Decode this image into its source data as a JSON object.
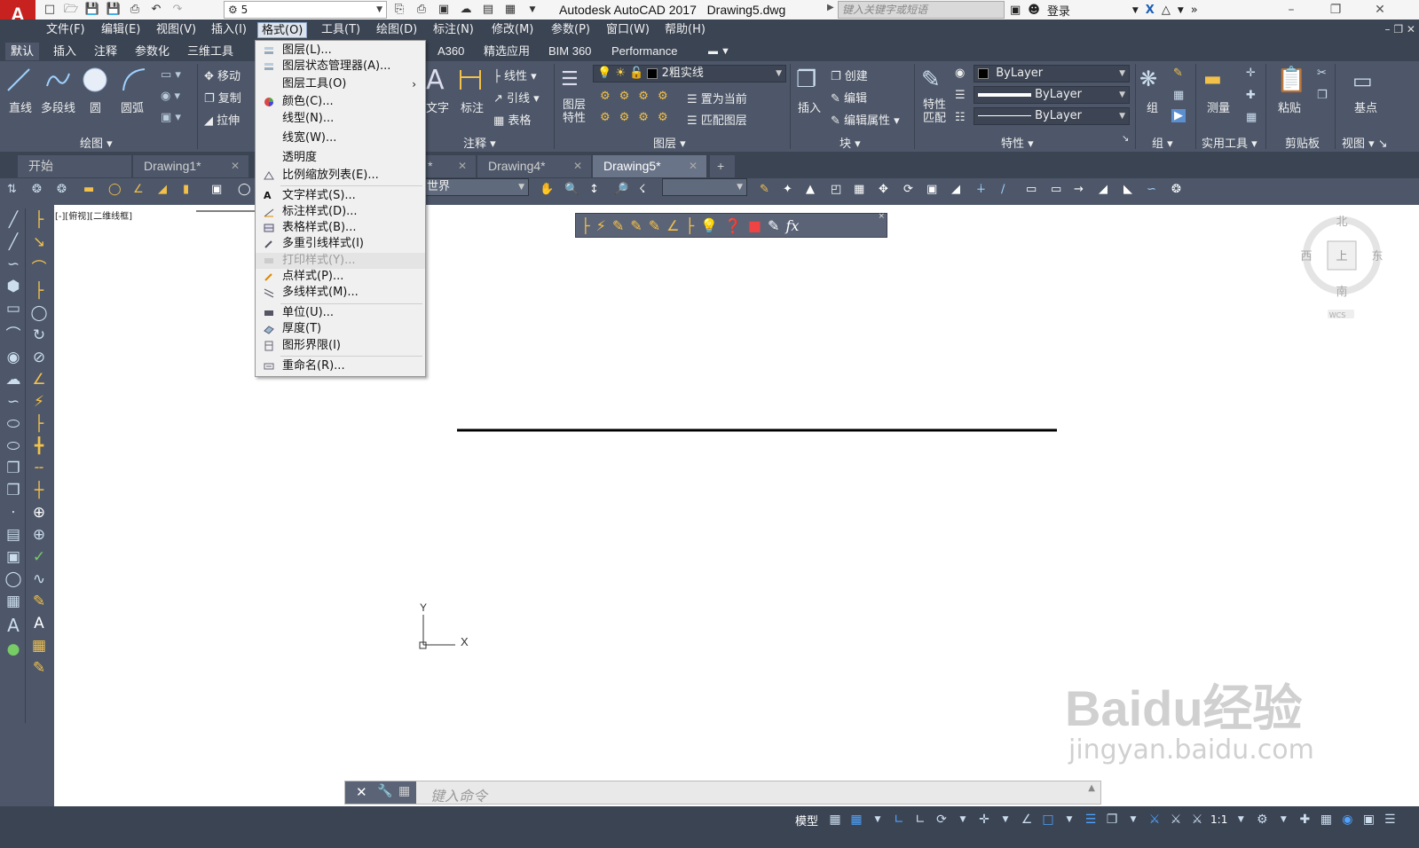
{
  "title_bar": {
    "app_title": "Autodesk AutoCAD 2017",
    "drawing_name": "Drawing5.dwg",
    "workspace_value": "5",
    "search_placeholder": "键入关键字或短语",
    "login_label": "登录"
  },
  "menu_bar": [
    {
      "label": "文件(F)"
    },
    {
      "label": "编辑(E)"
    },
    {
      "label": "视图(V)"
    },
    {
      "label": "插入(I)"
    },
    {
      "label": "格式(O)"
    },
    {
      "label": "工具(T)"
    },
    {
      "label": "绘图(D)"
    },
    {
      "label": "标注(N)"
    },
    {
      "label": "修改(M)"
    },
    {
      "label": "参数(P)"
    },
    {
      "label": "窗口(W)"
    },
    {
      "label": "帮助(H)"
    }
  ],
  "ribbon_tabs": [
    "默认",
    "插入",
    "注释",
    "参数化",
    "三维工具",
    "A360",
    "精选应用",
    "BIM 360",
    "Performance"
  ],
  "ribbon": {
    "draw": {
      "title": "绘图",
      "line": "直线",
      "polyline": "多段线",
      "circle": "圆",
      "arc": "圆弧"
    },
    "modify": {
      "move": "移动",
      "copy": "复制",
      "stretch": "拉伸"
    },
    "annotation": {
      "title": "注释",
      "text": "文字",
      "dimension": "标注",
      "linear": "线性",
      "leader": "引线",
      "table": "表格"
    },
    "layers": {
      "title": "图层",
      "layer_props": "图层特性",
      "current_layer": "2粗实线",
      "set_current": "置为当前",
      "match_layer": "匹配图层"
    },
    "block": {
      "title": "块",
      "insert": "插入",
      "create": "创建",
      "edit": "编辑",
      "edit_attr": "编辑属性"
    },
    "properties": {
      "title": "特性",
      "match": "特性匹配",
      "color": "ByLayer",
      "lineweight": "ByLayer",
      "linetype": "ByLayer"
    },
    "groups": {
      "title": "组",
      "group": "组"
    },
    "utilities": {
      "title": "实用工具",
      "measure": "测量"
    },
    "clipboard": {
      "title": "剪贴板",
      "paste": "粘贴"
    },
    "view": {
      "title": "视图",
      "base": "基点"
    }
  },
  "file_tabs": [
    {
      "label": "开始",
      "closable": false
    },
    {
      "label": "Drawing1*",
      "closable": true
    },
    {
      "label": "Drawing4*",
      "closable": true
    },
    {
      "label": "Drawing5*",
      "closable": true,
      "active": true
    }
  ],
  "toolbar2": {
    "ucs_value": "世界"
  },
  "viewport_label": "[-][俯视][二维线框]",
  "viewcube": {
    "north": "北",
    "south": "南",
    "east": "东",
    "west": "西",
    "top": "上",
    "wcs": "WCS"
  },
  "ucs_icon": {
    "x_label": "X",
    "y_label": "Y"
  },
  "command_line": {
    "placeholder": "键入命令"
  },
  "status_bar": {
    "model_label": "模型",
    "scale": "1:1"
  },
  "format_menu": {
    "items": [
      {
        "label": "图层(L)...",
        "icon": "layer-icon",
        "disabled": false
      },
      {
        "label": "图层状态管理器(A)...",
        "icon": "layer-state-icon",
        "disabled": false
      },
      {
        "label": "图层工具(O)",
        "icon": "",
        "disabled": false,
        "submenu": true
      },
      {
        "label": "颜色(C)...",
        "icon": "color-wheel-icon",
        "disabled": false
      },
      {
        "label": "线型(N)...",
        "icon": "",
        "disabled": false
      },
      {
        "label": "线宽(W)...",
        "icon": "",
        "disabled": false
      },
      {
        "label": "透明度",
        "icon": "",
        "disabled": false
      },
      {
        "label": "比例缩放列表(E)...",
        "icon": "scale-list-icon",
        "disabled": false
      },
      {
        "label": "文字样式(S)...",
        "icon": "text-style-icon",
        "disabled": false
      },
      {
        "label": "标注样式(D)...",
        "icon": "dim-style-icon",
        "disabled": false
      },
      {
        "label": "表格样式(B)...",
        "icon": "table-style-icon",
        "disabled": false
      },
      {
        "label": "多重引线样式(I)",
        "icon": "mleader-style-icon",
        "disabled": false
      },
      {
        "label": "打印样式(Y)...",
        "icon": "plot-style-icon",
        "disabled": true
      },
      {
        "label": "点样式(P)...",
        "icon": "point-style-icon",
        "disabled": false
      },
      {
        "label": "多线样式(M)...",
        "icon": "mline-style-icon",
        "disabled": false
      },
      {
        "label": "单位(U)...",
        "icon": "units-icon",
        "disabled": false
      },
      {
        "label": "厚度(T)",
        "icon": "thickness-icon",
        "disabled": false
      },
      {
        "label": "图形界限(I)",
        "icon": "limits-icon",
        "disabled": false
      },
      {
        "label": "重命名(R)...",
        "icon": "rename-icon",
        "disabled": false
      }
    ]
  },
  "watermark": {
    "brand": "Baidu经验",
    "url": "jingyan.baidu.com"
  },
  "colors": {
    "accent": "#c7221f",
    "dark_bg": "#3b4453",
    "panel_bg": "#4d5769",
    "menu_bg": "#f0f0f0"
  }
}
